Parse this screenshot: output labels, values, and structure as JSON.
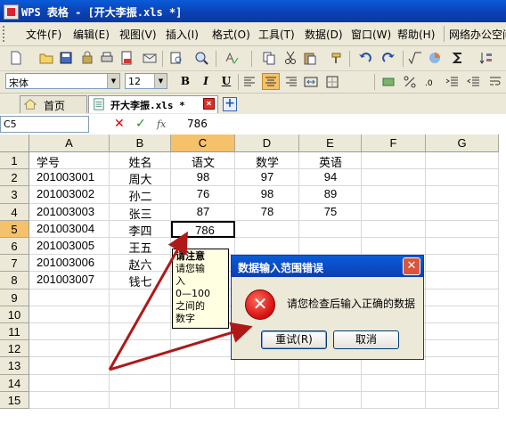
{
  "window": {
    "title": "WPS 表格 - [开大李振.xls *]"
  },
  "menu": {
    "items": [
      "文件(F)",
      "编辑(E)",
      "视图(V)",
      "插入(I)",
      "格式(O)",
      "工具(T)",
      "数据(D)",
      "窗口(W)",
      "帮助(H)",
      "网络办公空间"
    ]
  },
  "format": {
    "font_name": "宋体",
    "font_size": "12",
    "bold": "B",
    "italic": "I",
    "underline": "U"
  },
  "tabs": [
    {
      "label": "首页"
    },
    {
      "label": "开大李振.xls *"
    }
  ],
  "formula_bar": {
    "cell_ref": "C5",
    "fx": "fx",
    "value": "786"
  },
  "sheet": {
    "columns": [
      "A",
      "B",
      "C",
      "D",
      "E",
      "F",
      "G"
    ],
    "rows": [
      "1",
      "2",
      "3",
      "4",
      "5",
      "6",
      "7",
      "8",
      "9",
      "10",
      "11",
      "12",
      "13",
      "14",
      "15"
    ],
    "cells": {
      "r1": [
        "学号",
        "姓名",
        "语文",
        "数学",
        "英语"
      ],
      "r2": [
        "201003001",
        "周大",
        "98",
        "97",
        "94"
      ],
      "r3": [
        "201003002",
        "孙二",
        "76",
        "98",
        "89"
      ],
      "r4": [
        "201003003",
        "张三",
        "87",
        "78",
        "75"
      ],
      "r5": [
        "201003004",
        "李四",
        "786",
        "",
        ""
      ],
      "r6": [
        "201003005",
        "王五",
        "",
        "",
        ""
      ],
      "r7": [
        "201003006",
        "赵六",
        "",
        "",
        ""
      ],
      "r8": [
        "201003007",
        "钱七",
        "",
        "",
        ""
      ]
    }
  },
  "tooltip": {
    "title": "请注意",
    "lines": [
      "请您输",
      "入",
      "0—100",
      "之间的",
      "数字"
    ]
  },
  "dialog": {
    "title": "数据输入范围错误",
    "message": "请您检查后输入正确的数据",
    "retry": "重试(R)",
    "cancel": "取消"
  },
  "colors": {
    "title_blue": "#0b3fb3",
    "selection_orange": "#f5c16a",
    "arrow_red": "#b01818"
  }
}
